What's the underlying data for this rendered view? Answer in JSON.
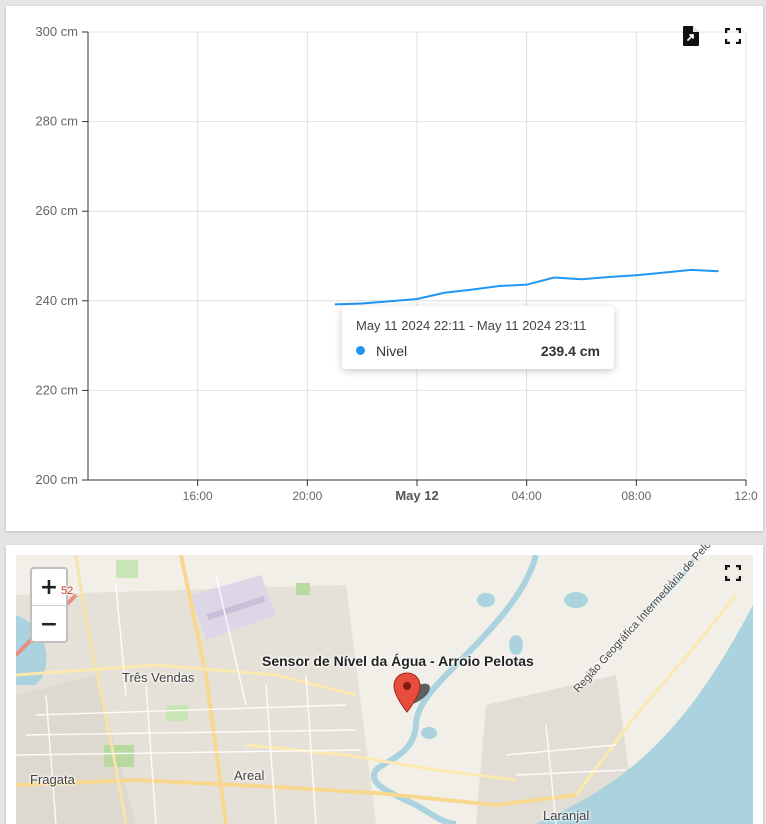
{
  "chart": {
    "unit": "cm",
    "y_ticks": [
      "300 cm",
      "280 cm",
      "260 cm",
      "240 cm",
      "220 cm",
      "200 cm"
    ],
    "x_ticks": [
      {
        "label": "16:00",
        "bold": false
      },
      {
        "label": "20:00",
        "bold": false
      },
      {
        "label": "May 12",
        "bold": true
      },
      {
        "label": "04:00",
        "bold": false
      },
      {
        "label": "08:00",
        "bold": false
      },
      {
        "label": "12:0",
        "bold": false
      }
    ],
    "line_color": "#2196f3",
    "export_icon": "file-export-icon",
    "fullscreen_icon": "fullscreen-icon"
  },
  "chart_data": {
    "type": "line",
    "x": [
      "2024-05-11 21:00",
      "2024-05-11 22:00",
      "2024-05-11 23:00",
      "2024-05-12 00:00",
      "2024-05-12 01:00",
      "2024-05-12 02:00",
      "2024-05-12 03:00",
      "2024-05-12 04:00",
      "2024-05-12 05:00",
      "2024-05-12 06:00",
      "2024-05-12 07:00",
      "2024-05-12 08:00",
      "2024-05-12 09:00",
      "2024-05-12 10:00",
      "2024-05-12 11:00"
    ],
    "series": [
      {
        "name": "Nivel",
        "values": [
          239.2,
          239.4,
          239.9,
          240.4,
          241.8,
          242.5,
          243.3,
          243.6,
          245.2,
          244.8,
          245.3,
          245.7,
          246.3,
          246.9,
          246.6
        ]
      }
    ],
    "ylim": [
      200,
      300
    ],
    "y_unit": "cm"
  },
  "tooltip": {
    "header": "May 11 2024 22:11 - May 11 2024 23:11",
    "series_name": "Nivel",
    "value": "239.4 cm",
    "dot_color": "#2196f3"
  },
  "map": {
    "zoom_in": "+",
    "zoom_out": "−",
    "sensor_label": "Sensor de Nível da Água - Arroio Pelotas",
    "places": {
      "tres_vendas": "Três Vendas",
      "fragata": "Fragata",
      "areal": "Areal",
      "laranjal": "Laranjal",
      "road": "Região Geográfica Intermediária de Pelotas",
      "route": "52"
    },
    "marker_color": "#e74c3c",
    "water_color": "#aad3df",
    "land_color": "#f2efe9"
  }
}
